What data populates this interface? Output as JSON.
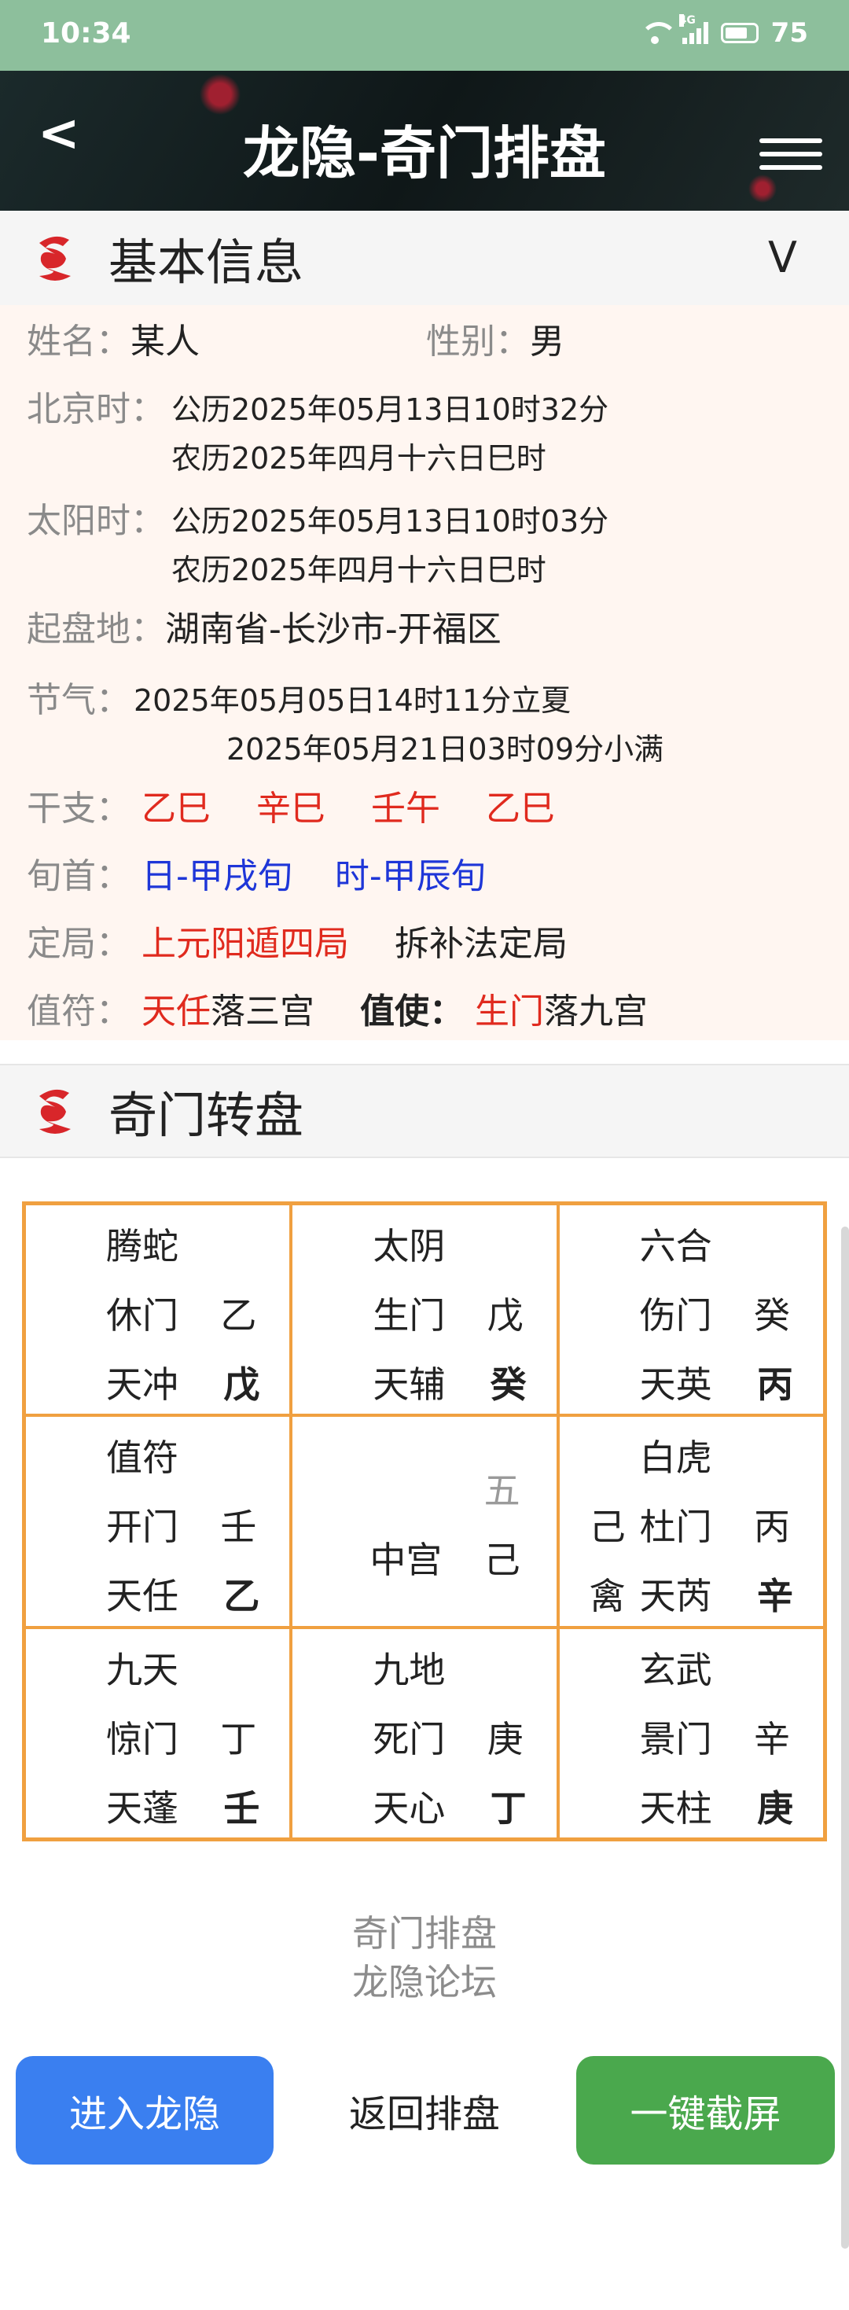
{
  "status_bar": {
    "time": "10:34",
    "network": "4G",
    "battery": "75"
  },
  "app_bar": {
    "title": "龙隐-奇门排盘"
  },
  "basic_info": {
    "title": "基本信息",
    "name_label": "姓名：",
    "name": "某人",
    "gender_label": "性别：",
    "gender": "男",
    "beijing_label": "北京时：",
    "beijing_solar": "公历2025年05月13日10时32分",
    "beijing_lunar": "农历2025年四月十六日巳时",
    "solar_label": "太阳时：",
    "solar_solar": "公历2025年05月13日10时03分",
    "solar_lunar": "农历2025年四月十六日巳时",
    "place_label": "起盘地：",
    "place": "湖南省-长沙市-开福区",
    "jieqi_label": "节气：",
    "jieqi_1": "2025年05月05日14时11分立夏",
    "jieqi_2": "2025年05月21日03时09分小满",
    "ganzhi_label": "干支：",
    "ganzhi": [
      "乙巳",
      "辛巳",
      "壬午",
      "乙巳"
    ],
    "xunshou_label": "旬首：",
    "xunshou_day": "日-甲戌旬",
    "xunshou_hour": "时-甲辰旬",
    "dingju_label": "定局：",
    "dingju": "上元阳遁四局",
    "dingju_method": "拆补法定局",
    "zhifu_label": "值符：",
    "zhifu_star": "天任",
    "zhifu_palace": "落三宫",
    "zhishi_label": "值使：",
    "zhishi_door": "生门",
    "zhishi_palace": "落九宫"
  },
  "wheel": {
    "title": "奇门转盘",
    "cells": [
      {
        "god": "腾蛇",
        "door": "休门",
        "door_stem": "乙",
        "star": "天冲",
        "star_stem": "戊"
      },
      {
        "god": "太阴",
        "door": "生门",
        "door_stem": "戊",
        "star": "天辅",
        "star_stem": "癸"
      },
      {
        "god": "六合",
        "door": "伤门",
        "door_stem": "癸",
        "star": "天英",
        "star_stem": "丙"
      },
      {
        "god": "值符",
        "door": "开门",
        "door_stem": "壬",
        "star": "天任",
        "star_stem": "乙"
      },
      {
        "number": "五",
        "name": "中宫",
        "stem": "己"
      },
      {
        "god": "白虎",
        "door_pre": "己",
        "door": "杜门",
        "door_stem": "丙",
        "star_pre": "禽",
        "star": "天芮",
        "star_stem": "辛"
      },
      {
        "god": "九天",
        "door": "惊门",
        "door_stem": "丁",
        "star": "天蓬",
        "star_stem": "壬"
      },
      {
        "god": "九地",
        "door": "死门",
        "door_stem": "庚",
        "star": "天心",
        "star_stem": "丁"
      },
      {
        "god": "玄武",
        "door": "景门",
        "door_stem": "辛",
        "star": "天柱",
        "star_stem": "庚"
      }
    ]
  },
  "footer": {
    "link_1": "奇门排盘",
    "link_2": "龙隐论坛",
    "enter_button": "进入龙隐",
    "return_button": "返回排盘",
    "screenshot_button": "一键截屏",
    "enter_color": "#3a7ff0",
    "screenshot_color": "#4aa84d"
  }
}
